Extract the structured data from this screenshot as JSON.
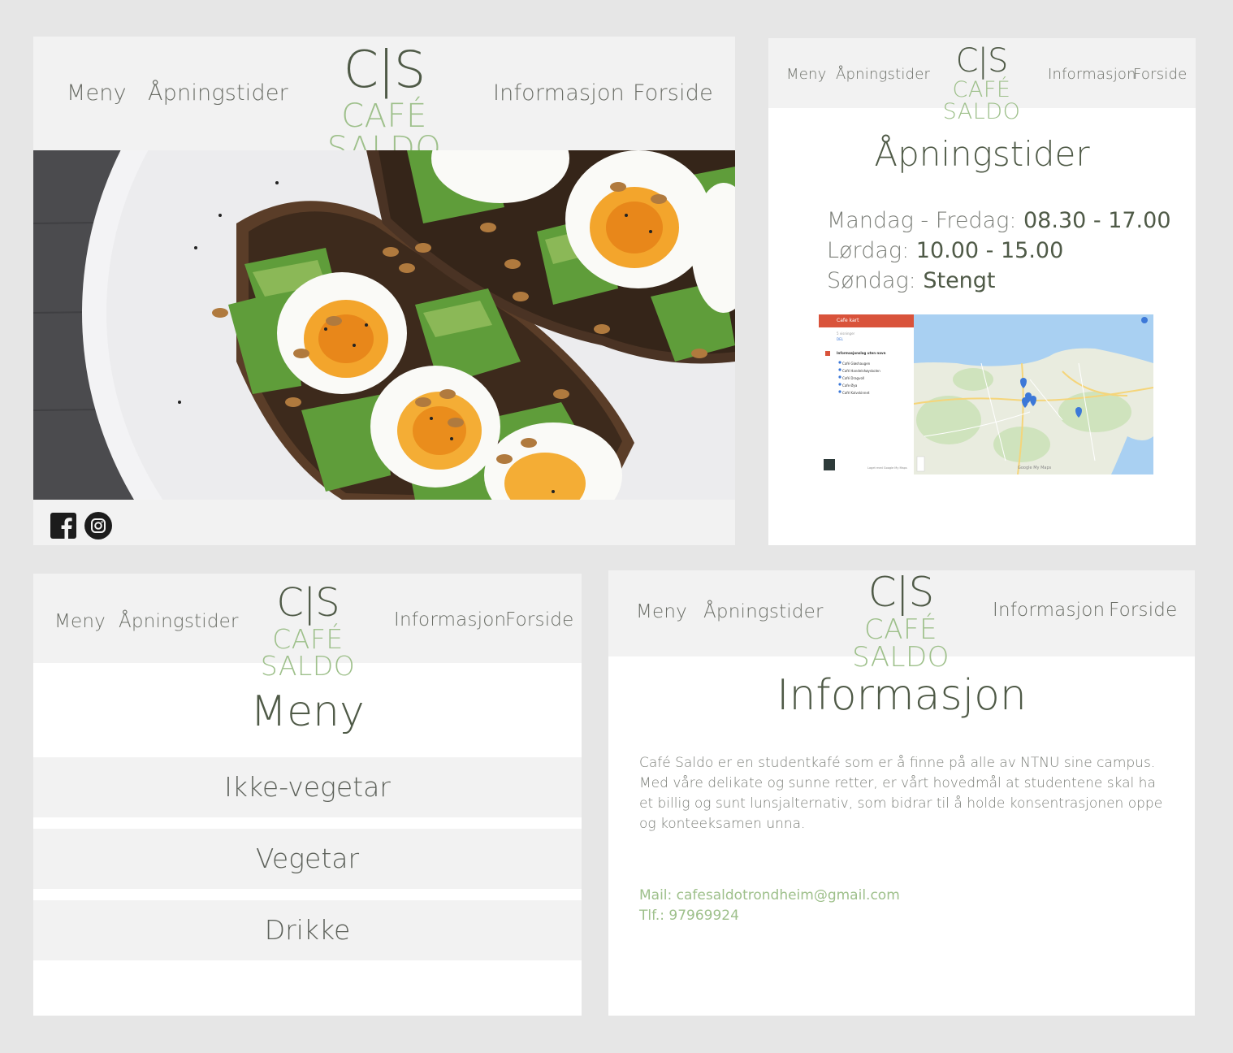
{
  "site": {
    "logo_mark": "C|S",
    "logo_name": "CAFÉ SALDO",
    "nav": {
      "menu": "Meny",
      "hours": "Åpningstider",
      "info": "Informasjon",
      "home": "Forside"
    }
  },
  "colors": {
    "brand_green": "#9ec08b",
    "dark_green": "#4f5a47",
    "header_bg": "#f2f2f2",
    "text_grey": "#7b7e78"
  },
  "home": {
    "social": [
      "facebook-icon",
      "instagram-icon"
    ]
  },
  "hours_page": {
    "title": "Åpningstider",
    "rows": [
      {
        "day": "Mandag - Fredag: ",
        "time": "08.30 - 17.00"
      },
      {
        "day": "Lørdag: ",
        "time": "10.00 - 15.00"
      },
      {
        "day": "Søndag: ",
        "time": "Stengt"
      }
    ],
    "map": {
      "panel_title": "Cafe kart",
      "views": "5 visninger",
      "share": "DEL",
      "layer_title": "Informasjonslag uten navn",
      "places": [
        "Café Gløshaugen",
        "Café Handelshøyskolen",
        "Café Dragvoll",
        "Cafe Øya",
        "Café Kalvskinnet"
      ],
      "footer": "Laget med Google My Maps",
      "brand": "Google My Maps"
    }
  },
  "menu_page": {
    "title": "Meny",
    "categories": [
      "Ikke-vegetar",
      "Vegetar",
      "Drikke"
    ]
  },
  "info_page": {
    "title": "Informasjon",
    "body": "Café Saldo er en studentkafé som er å finne på alle av NTNU sine campus. Med våre delikate og sunne retter, er vårt hovedmål at studentene skal ha et billig og sunt lunsjalternativ, som bidrar til å holde konsentrasjonen oppe og konteeksamen unna.",
    "mail_label": "Mail: ",
    "mail": "cafesaldotrondheim@gmail.com",
    "phone_label": "Tlf.: ",
    "phone": "97969924"
  }
}
